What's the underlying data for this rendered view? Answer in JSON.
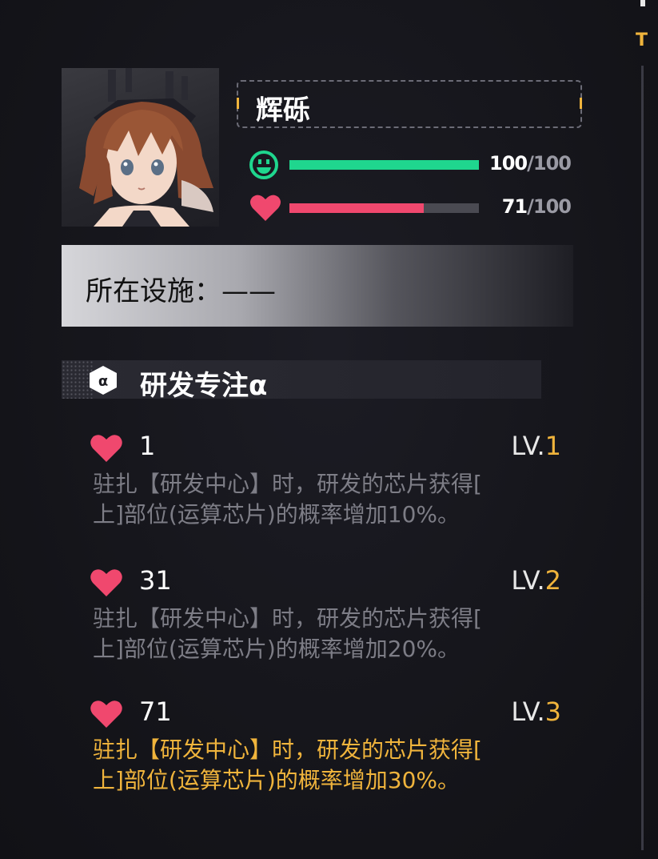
{
  "character": {
    "name": "辉砾",
    "mood": {
      "current": "100",
      "max": "/100",
      "fraction": 1.0,
      "color": "#1fd68e",
      "icon": "smiley-face-icon"
    },
    "affection": {
      "current": "71",
      "max": "/100",
      "fraction": 0.71,
      "color": "#f0486e",
      "icon": "heart-icon"
    }
  },
  "facility": {
    "label": "所在设施：——"
  },
  "skill": {
    "icon": "alpha-hexagon-icon",
    "icon_glyph": "α",
    "title": "研发专注α",
    "levels": [
      {
        "requirement": "1",
        "lv_prefix": "LV.",
        "lv_num": "1",
        "desc_line1": "驻扎【研发中心】时，研发的芯片获得[",
        "desc_line2": "上]部位(运算芯片)的概率增加10%。",
        "active": false
      },
      {
        "requirement": "31",
        "lv_prefix": "LV.",
        "lv_num": "2",
        "desc_line1": "驻扎【研发中心】时，研发的芯片获得[",
        "desc_line2": "上]部位(运算芯片)的概率增加20%。",
        "active": false
      },
      {
        "requirement": "71",
        "lv_prefix": "LV.",
        "lv_num": "3",
        "desc_line1": "驻扎【研发中心】时，研发的芯片获得[",
        "desc_line2": "上]部位(运算芯片)的概率增加30%。",
        "active": true
      }
    ]
  },
  "scrollbar": {
    "letter": "T"
  },
  "colors": {
    "accent": "#f0b43c",
    "mood": "#1fd68e",
    "heart": "#f0486e",
    "inactive_text": "#7d7d86"
  }
}
